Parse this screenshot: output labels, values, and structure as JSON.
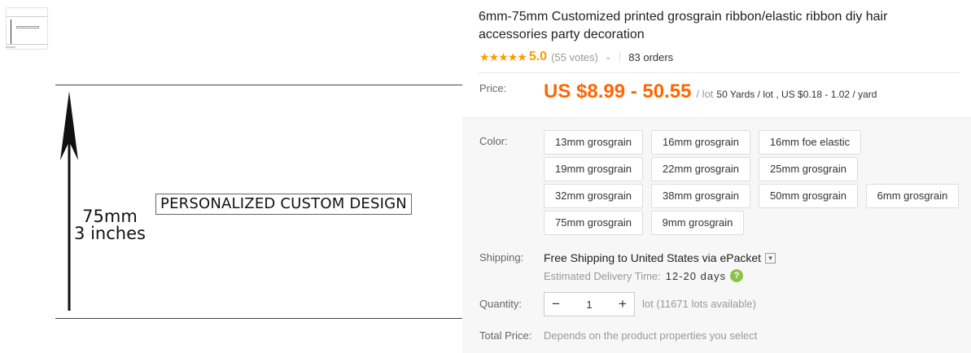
{
  "gallery": {
    "main_image": {
      "dimension_mm": "75mm",
      "dimension_in": "3 inches",
      "custom_text": "PERSONALIZED CUSTOM DESIGN"
    }
  },
  "product": {
    "title": "6mm-75mm Customized printed grosgrain ribbon/elastic ribbon diy hair accessories party decoration",
    "rating": {
      "stars": 5,
      "score": "5.0",
      "votes": "(55 votes)",
      "orders": "83 orders"
    },
    "price": {
      "label": "Price:",
      "range": "US $8.99 - 50.55",
      "unit": "/ lot",
      "extra": "50 Yards / lot , US $0.18 - 1.02 / yard"
    },
    "color": {
      "label": "Color:",
      "options": [
        "13mm grosgrain",
        "16mm grosgrain",
        "16mm foe elastic",
        "19mm grosgrain",
        "22mm grosgrain",
        "25mm grosgrain",
        "32mm grosgrain",
        "38mm grosgrain",
        "50mm grosgrain",
        "6mm grosgrain",
        "75mm grosgrain",
        "9mm grosgrain"
      ]
    },
    "shipping": {
      "label": "Shipping:",
      "free": "Free Shipping to",
      "destination": "United States via ePacket",
      "delivery_label": "Estimated Delivery Time:",
      "delivery_days": "12-20 days"
    },
    "quantity": {
      "label": "Quantity:",
      "minus": "−",
      "value": "1",
      "plus": "+",
      "available": "lot (11671 lots available)"
    },
    "total": {
      "label": "Total Price:",
      "text": "Depends on the product properties you select"
    }
  },
  "colors": {
    "accent": "#ff6600",
    "star": "#ff9a00",
    "help_icon": "#8bc34a"
  }
}
